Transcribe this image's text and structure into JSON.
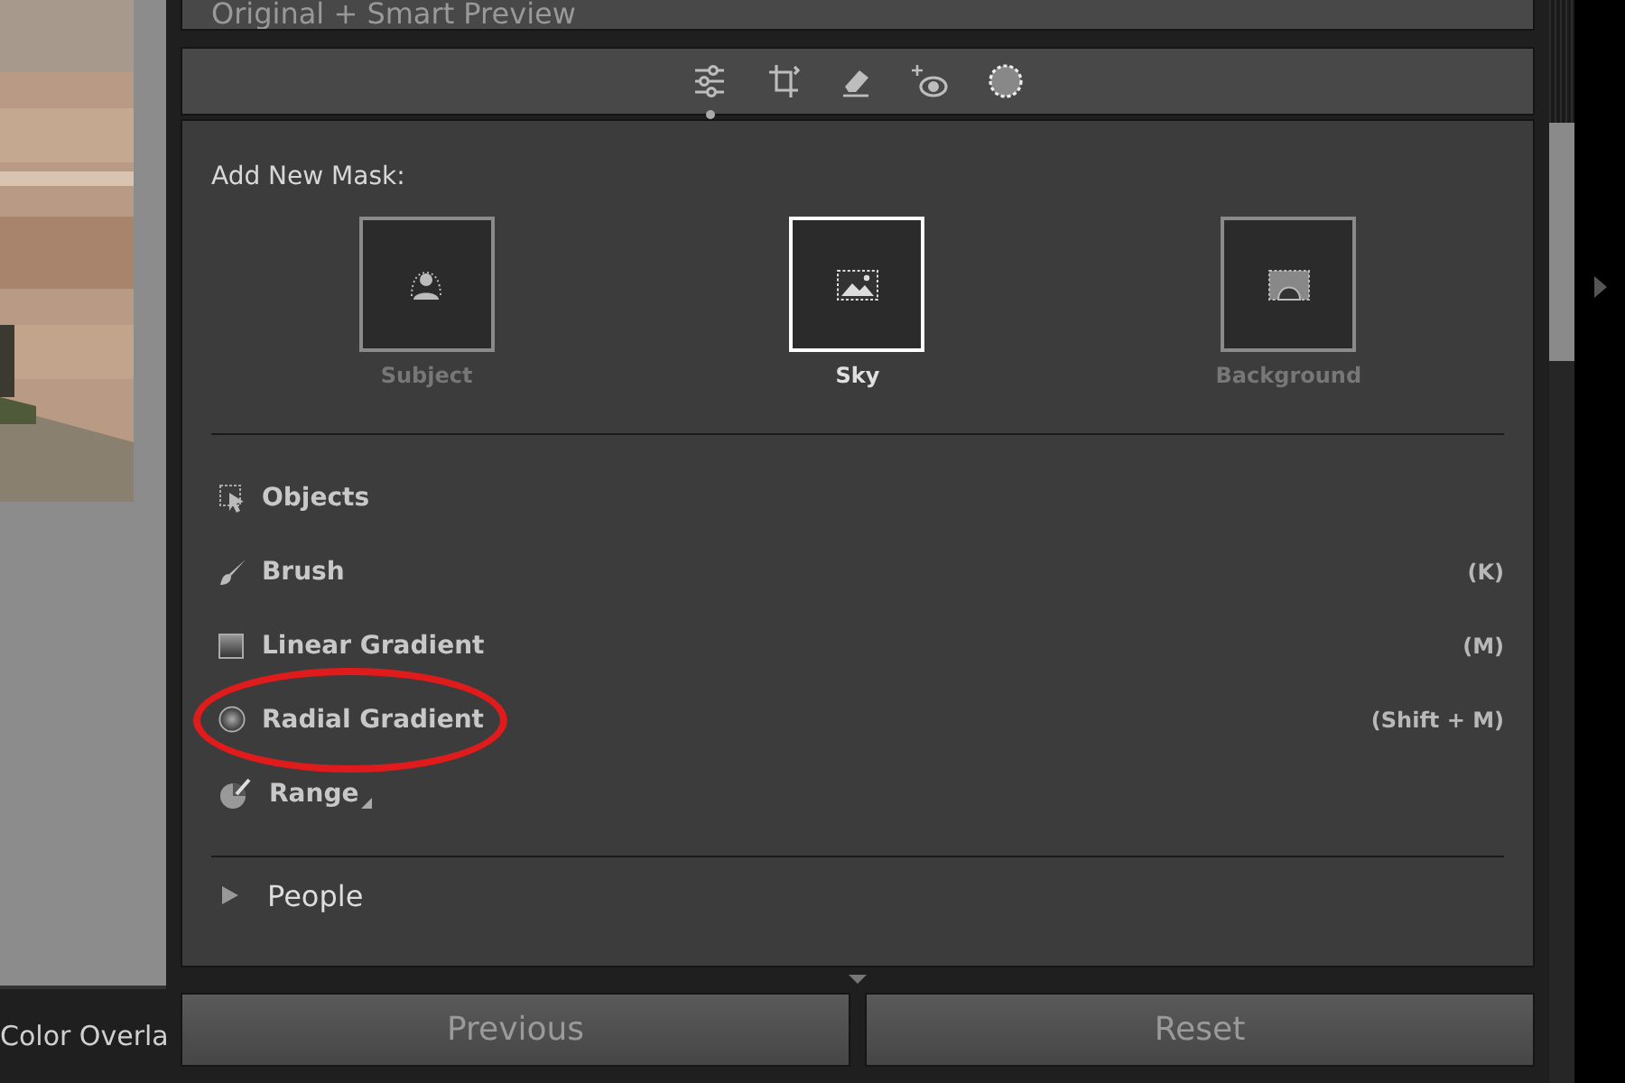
{
  "header": {
    "text": "Original + Smart Preview"
  },
  "left_pane": {
    "caption": "Color Overla"
  },
  "toolbar": {
    "tools": [
      {
        "kind": "sliders",
        "selected": true
      },
      {
        "kind": "crop",
        "selected": false
      },
      {
        "kind": "eraser",
        "selected": false
      },
      {
        "kind": "redeye",
        "selected": false
      },
      {
        "kind": "mask",
        "selected": false
      }
    ]
  },
  "mask_panel": {
    "title": "Add New Mask:",
    "presets": [
      {
        "label": "Subject",
        "kind": "subject",
        "selected": false
      },
      {
        "label": "Sky",
        "kind": "sky",
        "selected": true
      },
      {
        "label": "Background",
        "kind": "background",
        "selected": false
      }
    ],
    "tools": [
      {
        "label": "Objects",
        "kind": "objects",
        "circled": false
      },
      {
        "label": "Brush",
        "kind": "brush",
        "shortcut": "(K)",
        "circled": false
      },
      {
        "label": "Linear Gradient",
        "kind": "linear",
        "shortcut": "(M)",
        "circled": false
      },
      {
        "label": "Radial Gradient",
        "kind": "radial",
        "shortcut": "(Shift + M)",
        "circled": true
      },
      {
        "label": "Range",
        "kind": "range",
        "circled": false
      }
    ],
    "sections": [
      {
        "label": "People",
        "expanded": false
      }
    ]
  },
  "buttons": [
    {
      "label": "Previous"
    },
    {
      "label": "Reset"
    }
  ]
}
